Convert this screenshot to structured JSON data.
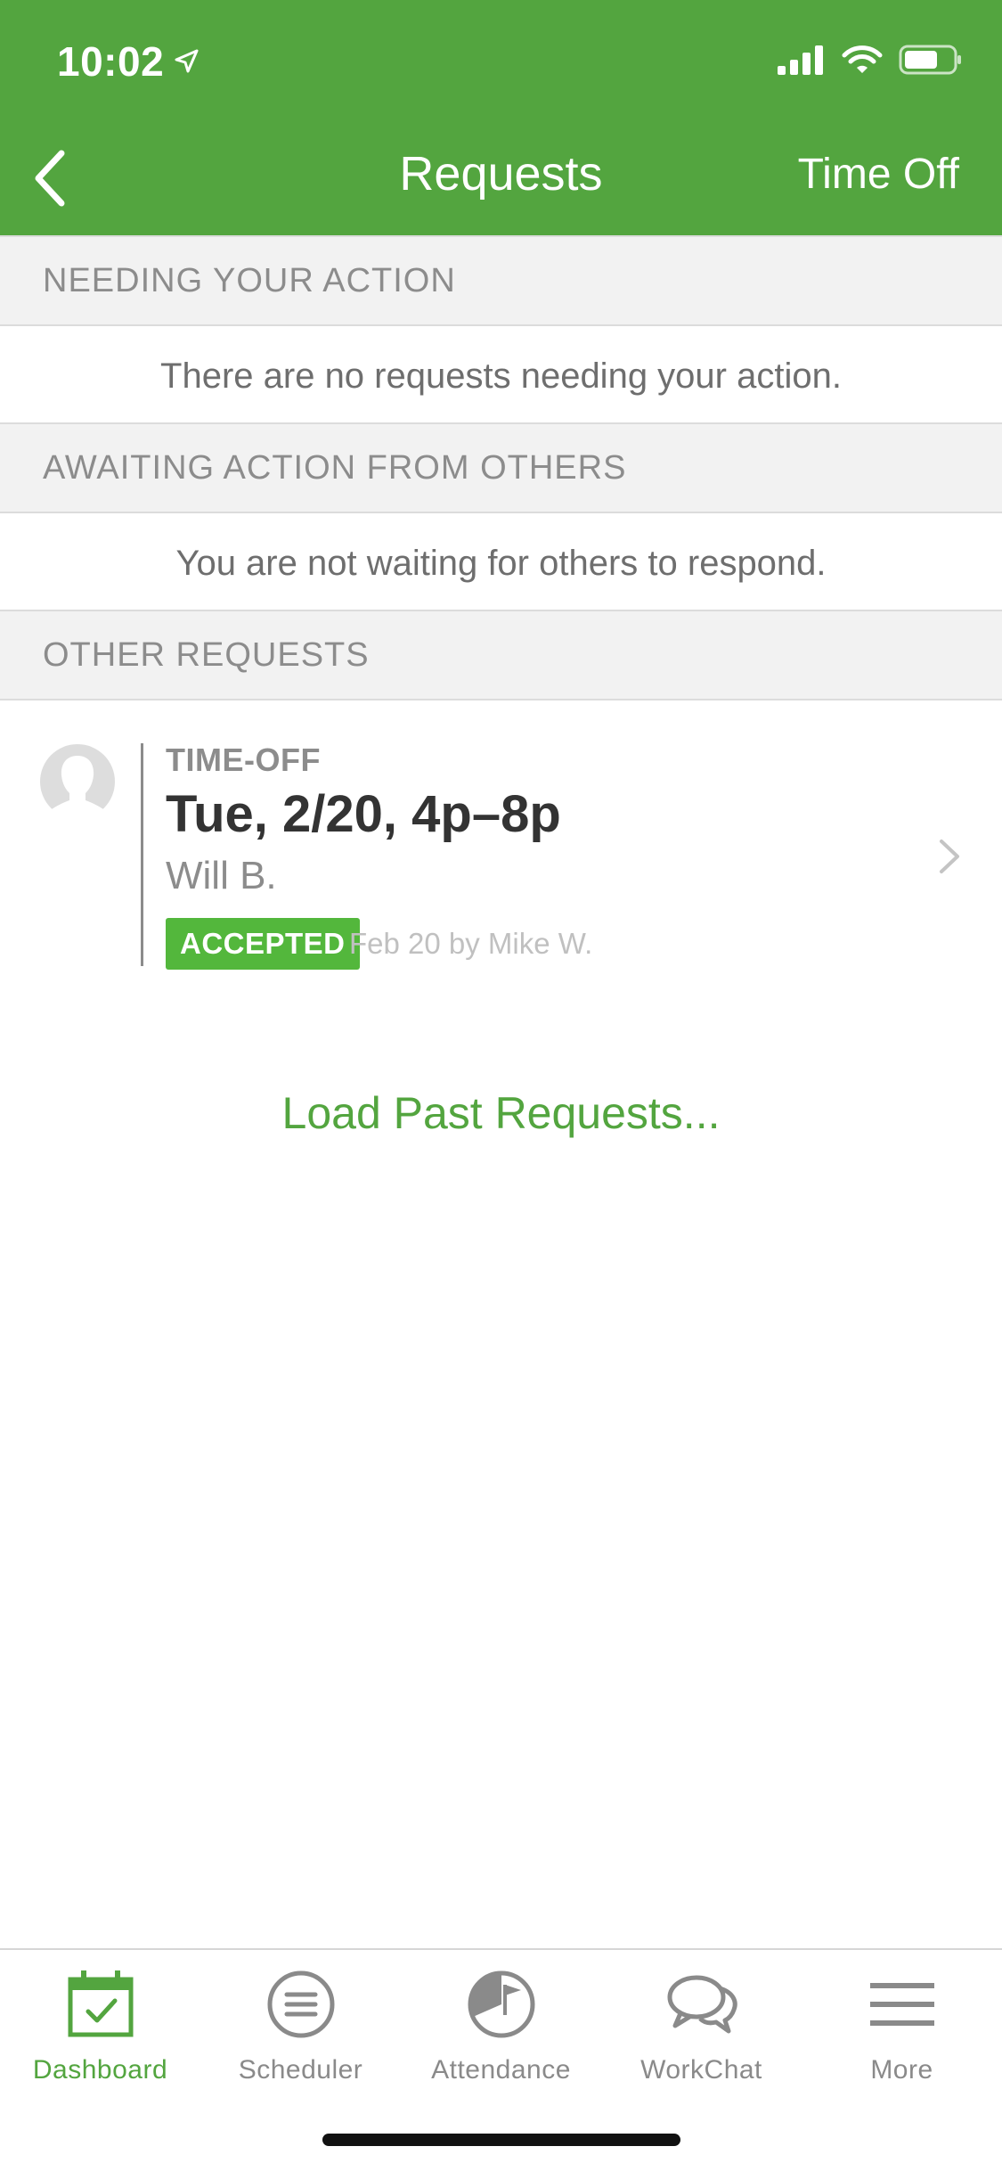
{
  "status_bar": {
    "time": "10:02"
  },
  "nav": {
    "title": "Requests",
    "right_button": "Time Off"
  },
  "sections": [
    {
      "header": "NEEDING YOUR ACTION",
      "empty_text": "There are no requests needing your action."
    },
    {
      "header": "AWAITING ACTION FROM OTHERS",
      "empty_text": "You are not waiting for others to respond."
    },
    {
      "header": "OTHER REQUESTS"
    }
  ],
  "requests": [
    {
      "type": "TIME-OFF",
      "date": "Tue, 2/20, 4p–8p",
      "name": "Will B.",
      "status": "ACCEPTED",
      "meta": "Feb 20 by Mike W."
    }
  ],
  "load_past_label": "Load Past Requests...",
  "tabbar": {
    "tabs": [
      {
        "label": "Dashboard",
        "icon": "calendar-check-icon",
        "active": true
      },
      {
        "label": "Scheduler",
        "icon": "list-circle-icon"
      },
      {
        "label": "Attendance",
        "icon": "clock-flag-icon"
      },
      {
        "label": "WorkChat",
        "icon": "chat-bubbles-icon"
      },
      {
        "label": "More",
        "icon": "hamburger-menu-icon"
      }
    ]
  },
  "colors": {
    "brand_green": "#53a53f",
    "badge_green": "#53b73c",
    "section_bg": "#f2f2f2",
    "muted_text": "#8c8c8c"
  }
}
